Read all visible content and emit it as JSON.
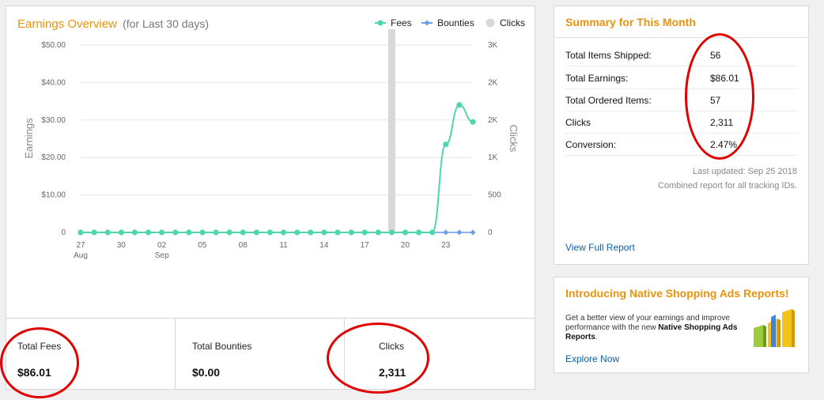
{
  "earnings": {
    "title": "Earnings Overview",
    "subtitle": "(for Last 30 days)",
    "legend": {
      "fees": "Fees",
      "bounties": "Bounties",
      "clicks": "Clicks"
    },
    "colors": {
      "fees": "#4fd6b0",
      "bounties": "#6a9ee6",
      "clicks": "#d8d8d8",
      "accent": "#e8930c"
    }
  },
  "chart_data": {
    "type": "line",
    "title": "Earnings Overview",
    "subtitle": "(for Last 30 days)",
    "ylabel": "Earnings",
    "y2label": "Clicks",
    "ylim": [
      0,
      50
    ],
    "y2lim": [
      0,
      3000
    ],
    "yticks": [
      "$50.00",
      "$40.00",
      "$30.00",
      "$20.00",
      "$10.00",
      "0"
    ],
    "y2ticks": [
      "3K",
      "2K",
      "2K",
      "1K",
      "500",
      "0"
    ],
    "xticks": [
      {
        "day": 27,
        "label": "27",
        "sub": "Aug"
      },
      {
        "day": 30,
        "label": "30",
        "sub": ""
      },
      {
        "day": 33,
        "label": "02",
        "sub": "Sep"
      },
      {
        "day": 36,
        "label": "05",
        "sub": ""
      },
      {
        "day": 39,
        "label": "08",
        "sub": ""
      },
      {
        "day": 42,
        "label": "11",
        "sub": ""
      },
      {
        "day": 45,
        "label": "14",
        "sub": ""
      },
      {
        "day": 48,
        "label": "17",
        "sub": ""
      },
      {
        "day": 51,
        "label": "20",
        "sub": ""
      },
      {
        "day": 54,
        "label": "23",
        "sub": ""
      }
    ],
    "x": [
      27,
      28,
      29,
      30,
      31,
      32,
      33,
      34,
      35,
      36,
      37,
      38,
      39,
      40,
      41,
      42,
      43,
      44,
      45,
      46,
      47,
      48,
      49,
      50,
      51,
      52,
      53,
      54,
      55,
      56
    ],
    "series": [
      {
        "name": "Fees",
        "type": "line",
        "values": [
          0,
          0,
          0,
          0,
          0,
          0,
          0,
          0,
          0,
          0,
          0,
          0,
          0,
          0,
          0,
          0,
          0,
          0,
          0,
          0,
          0,
          0,
          0,
          0,
          0,
          0,
          0,
          23.5,
          34,
          29.5
        ]
      },
      {
        "name": "Bounties",
        "type": "line",
        "values": [
          0,
          0,
          0,
          0,
          0,
          0,
          0,
          0,
          0,
          0,
          0,
          0,
          0,
          0,
          0,
          0,
          0,
          0,
          0,
          0,
          0,
          0,
          0,
          0,
          0,
          0,
          0,
          0,
          0,
          0
        ]
      },
      {
        "name": "Clicks",
        "type": "bar",
        "values": [
          0,
          0,
          0,
          0,
          0,
          0,
          0,
          0,
          0,
          0,
          0,
          0,
          0,
          0,
          0,
          0,
          0,
          0,
          0,
          0,
          0,
          0,
          0,
          2311,
          0,
          0,
          0,
          0,
          0,
          0
        ]
      }
    ]
  },
  "stats": [
    {
      "label": "Total Fees",
      "value": "$86.01"
    },
    {
      "label": "Total Bounties",
      "value": "$0.00"
    },
    {
      "label": "Clicks",
      "value": "2,311"
    }
  ],
  "summary": {
    "title": "Summary for This Month",
    "rows": [
      {
        "label": "Total Items Shipped:",
        "value": "56"
      },
      {
        "label": "Total Earnings:",
        "value": "$86.01"
      },
      {
        "label": "Total Ordered Items:",
        "value": "57"
      },
      {
        "label": "Clicks",
        "value": "2,311"
      },
      {
        "label": "Conversion:",
        "value": "2.47%"
      }
    ],
    "last_updated": "Last updated: Sep 25 2018",
    "note": "Combined report for all tracking IDs.",
    "view_full_report": "View Full Report"
  },
  "promo": {
    "title": "Introducing Native Shopping Ads Reports!",
    "text_before": "Get a better view of your earnings and improve performance with the new ",
    "text_bold": "Native Shopping Ads Reports",
    "text_after": ".",
    "link": "Explore Now"
  }
}
